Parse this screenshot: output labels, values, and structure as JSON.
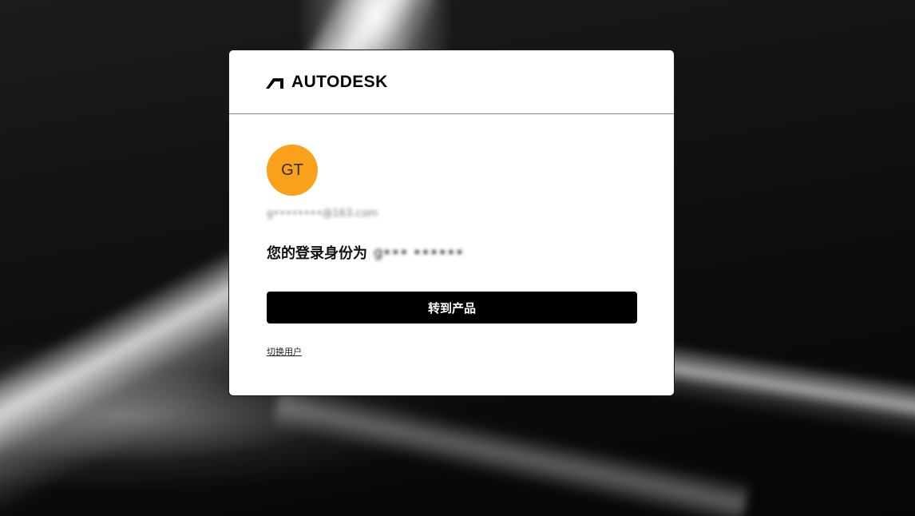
{
  "brand": {
    "logo_text": "AUTODESK",
    "logo_icon": "autodesk-logo-mark"
  },
  "account": {
    "avatar_initials": "GT",
    "avatar_color": "#f9a11b",
    "email": "g••••••••@163.com",
    "signed_in_label": "您的登录身份为",
    "display_name": "g••• ••••••"
  },
  "actions": {
    "go_to_products_label": "转到产品",
    "switch_user_label": "切换用户"
  },
  "colors": {
    "button_bg": "#000000",
    "card_bg": "#ffffff",
    "page_bg": "#111111"
  }
}
